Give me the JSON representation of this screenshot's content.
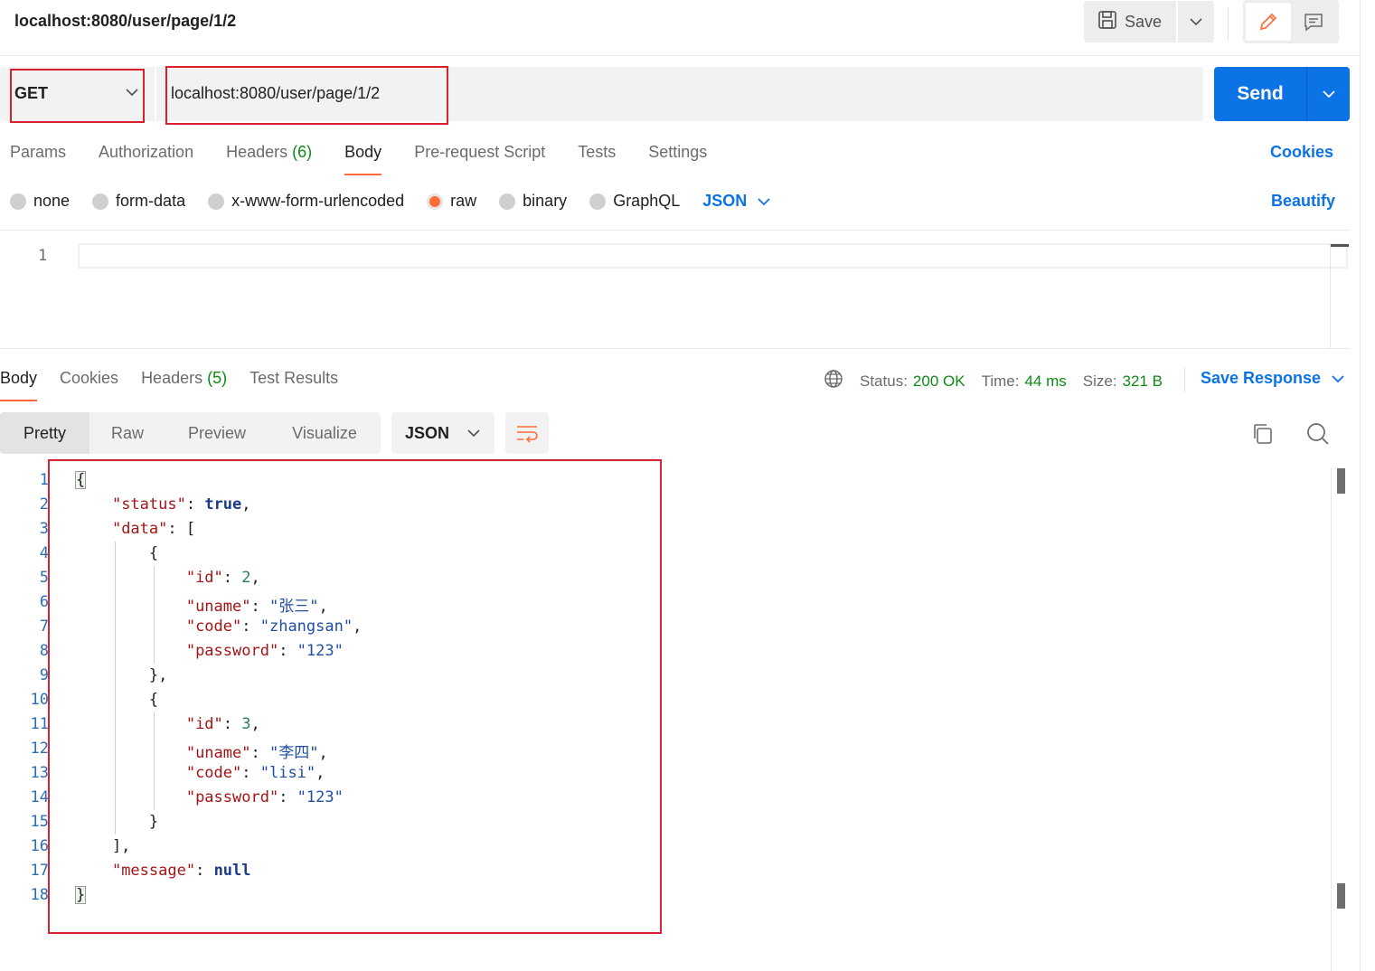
{
  "header": {
    "request_name": "localhost:8080/user/page/1/2",
    "save_label": "Save"
  },
  "request": {
    "method": "GET",
    "url": "localhost:8080/user/page/1/2",
    "send_label": "Send",
    "tabs": [
      {
        "label": "Params",
        "count": ""
      },
      {
        "label": "Authorization",
        "count": ""
      },
      {
        "label": "Headers",
        "count": "(6)"
      },
      {
        "label": "Body",
        "count": ""
      },
      {
        "label": "Pre-request Script",
        "count": ""
      },
      {
        "label": "Tests",
        "count": ""
      },
      {
        "label": "Settings",
        "count": ""
      }
    ],
    "active_tab": "Body",
    "cookies_label": "Cookies",
    "body_types": [
      "none",
      "form-data",
      "x-www-form-urlencoded",
      "raw",
      "binary",
      "GraphQL"
    ],
    "selected_body_type": "raw",
    "body_format": "JSON",
    "beautify_label": "Beautify",
    "editor_line": "1"
  },
  "response": {
    "tabs": [
      {
        "label": "Body",
        "count": ""
      },
      {
        "label": "Cookies",
        "count": ""
      },
      {
        "label": "Headers",
        "count": "(5)"
      },
      {
        "label": "Test Results",
        "count": ""
      }
    ],
    "status_label": "Status:",
    "status_value": "200 OK",
    "time_label": "Time:",
    "time_value": "44 ms",
    "size_label": "Size:",
    "size_value": "321 B",
    "save_response_label": "Save Response",
    "views": [
      "Pretty",
      "Raw",
      "Preview",
      "Visualize"
    ],
    "active_view": "Pretty",
    "format": "JSON",
    "lines": [
      "{",
      "    \"status\": true,",
      "    \"data\": [",
      "        {",
      "            \"id\": 2,",
      "            \"uname\": \"张三\",",
      "            \"code\": \"zhangsan\",",
      "            \"password\": \"123\"",
      "        },",
      "        {",
      "            \"id\": 3,",
      "            \"uname\": \"李四\",",
      "            \"code\": \"lisi\",",
      "            \"password\": \"123\"",
      "        }",
      "    ],",
      "    \"message\": null",
      "}"
    ]
  },
  "colors": {
    "accent": "#ff6c37",
    "link": "#0b73e5",
    "send": "#0b73e5",
    "success": "#0e8a16",
    "highlight_box": "#d9202f"
  }
}
